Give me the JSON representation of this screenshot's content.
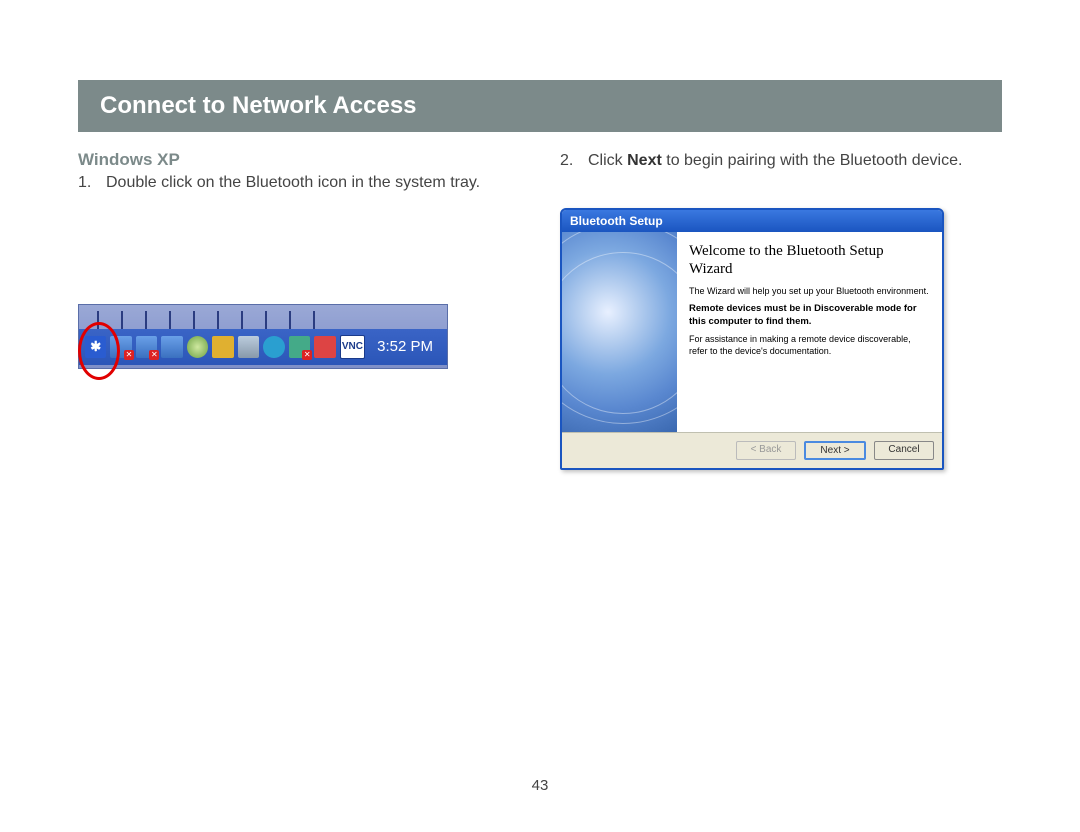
{
  "header": {
    "title": "Connect to Network Access"
  },
  "left": {
    "subhead": "Windows XP",
    "step1_num": "1.",
    "step1_text": "Double click on the Bluetooth icon in the system tray.",
    "tray_time": "3:52 PM",
    "vnc_label": "VNC"
  },
  "right": {
    "step2_num": "2.",
    "step2_prefix": "Click ",
    "step2_bold": "Next",
    "step2_suffix": " to begin pairing with the Bluetooth device.",
    "wizard": {
      "title": "Bluetooth Setup",
      "heading": "Welcome to the Bluetooth Setup Wizard",
      "intro": "The Wizard will help you set up your Bluetooth environment.",
      "note": "Remote devices must be in Discoverable mode for this computer to find them.",
      "assist": "For assistance in making a remote device discoverable, refer to the device's documentation.",
      "back": "< Back",
      "next": "Next >",
      "cancel": "Cancel"
    }
  },
  "page_number": "43"
}
